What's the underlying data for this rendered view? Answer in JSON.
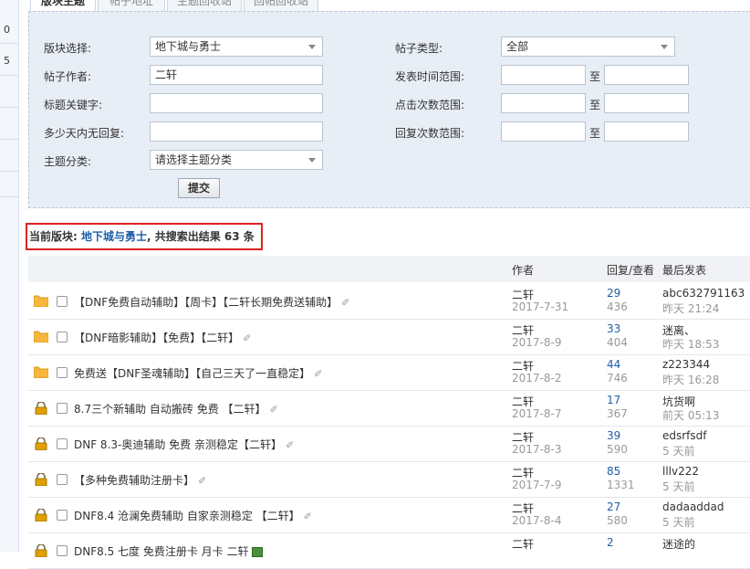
{
  "sidebar": {
    "numbers": [
      "0",
      "5"
    ]
  },
  "tabs": [
    "版块主题",
    "帖子地址",
    "主题回收站",
    "回帖回收站"
  ],
  "search": {
    "forum_label": "版块选择:",
    "forum_value": "地下城与勇士",
    "author_label": "帖子作者:",
    "author_value": "二轩",
    "keyword_label": "标题关键字:",
    "keyword_value": "",
    "noreply_label": "多少天内无回复:",
    "noreply_value": "",
    "category_label": "主题分类:",
    "category_value": "请选择主题分类",
    "post_type_label": "帖子类型:",
    "post_type_value": "全部",
    "time_range_label": "发表时间范围:",
    "click_range_label": "点击次数范围:",
    "reply_range_label": "回复次数范围:",
    "range_sep": "至",
    "submit_label": "提交"
  },
  "result": {
    "prefix": "当前版块:",
    "forum": "地下城与勇士",
    "suffix": ", 共搜索出结果 63 条"
  },
  "table": {
    "headers": {
      "author": "作者",
      "reply_view": "回复/查看",
      "last_post": "最后发表"
    },
    "rows": [
      {
        "icon": "folder",
        "title": "【DNF免费自动辅助】【周卡】【二轩长期免费送辅助】",
        "attach": "clip",
        "author": "二轩",
        "date": "2017-7-31",
        "replies": "29",
        "views": "436",
        "last_user": "abc632791163",
        "last_time": "昨天 21:24"
      },
      {
        "icon": "folder",
        "title": "【DNF暗影辅助】【免费】【二轩】",
        "attach": "clip",
        "author": "二轩",
        "date": "2017-8-9",
        "replies": "33",
        "views": "404",
        "last_user": "迷离、",
        "last_time": "昨天 18:53"
      },
      {
        "icon": "folder",
        "title": "免费送【DNF圣魂辅助】【自己三天了一直稳定】",
        "attach": "clip",
        "author": "二轩",
        "date": "2017-8-2",
        "replies": "44",
        "views": "746",
        "last_user": "z223344",
        "last_time": "昨天 16:28"
      },
      {
        "icon": "lock",
        "title": "8.7三个新辅助 自动搬砖 免费 【二轩】",
        "attach": "clip",
        "author": "二轩",
        "date": "2017-8-7",
        "replies": "17",
        "views": "367",
        "last_user": "坑货啊",
        "last_time": "前天 05:13"
      },
      {
        "icon": "lock",
        "title": "DNF 8.3-奥迪辅助 免费 亲测稳定【二轩】",
        "attach": "clip",
        "author": "二轩",
        "date": "2017-8-3",
        "replies": "39",
        "views": "590",
        "last_user": "edsrfsdf",
        "last_time": "5 天前"
      },
      {
        "icon": "lock",
        "title": "【多种免费辅助注册卡】",
        "attach": "clip",
        "author": "二轩",
        "date": "2017-7-9",
        "replies": "85",
        "views": "1331",
        "last_user": "lllv222",
        "last_time": "5 天前"
      },
      {
        "icon": "lock",
        "title": "DNF8.4 沧澜免费辅助 自家亲测稳定 【二轩】",
        "attach": "clip",
        "author": "二轩",
        "date": "2017-8-4",
        "replies": "27",
        "views": "580",
        "last_user": "dadaaddad",
        "last_time": "5 天前"
      },
      {
        "icon": "lock",
        "title": "DNF8.5 七度 免费注册卡 月卡 二轩",
        "attach": "image",
        "author": "二轩",
        "date": "",
        "replies": "2",
        "views": "",
        "last_user": "迷途的",
        "last_time": ""
      }
    ]
  },
  "colors": {
    "panel_bg": "#e8eef6",
    "link": "#1f5ea8",
    "highlight_border": "#e02020",
    "folder": "#f6b73c",
    "lock": "#e0a000"
  }
}
